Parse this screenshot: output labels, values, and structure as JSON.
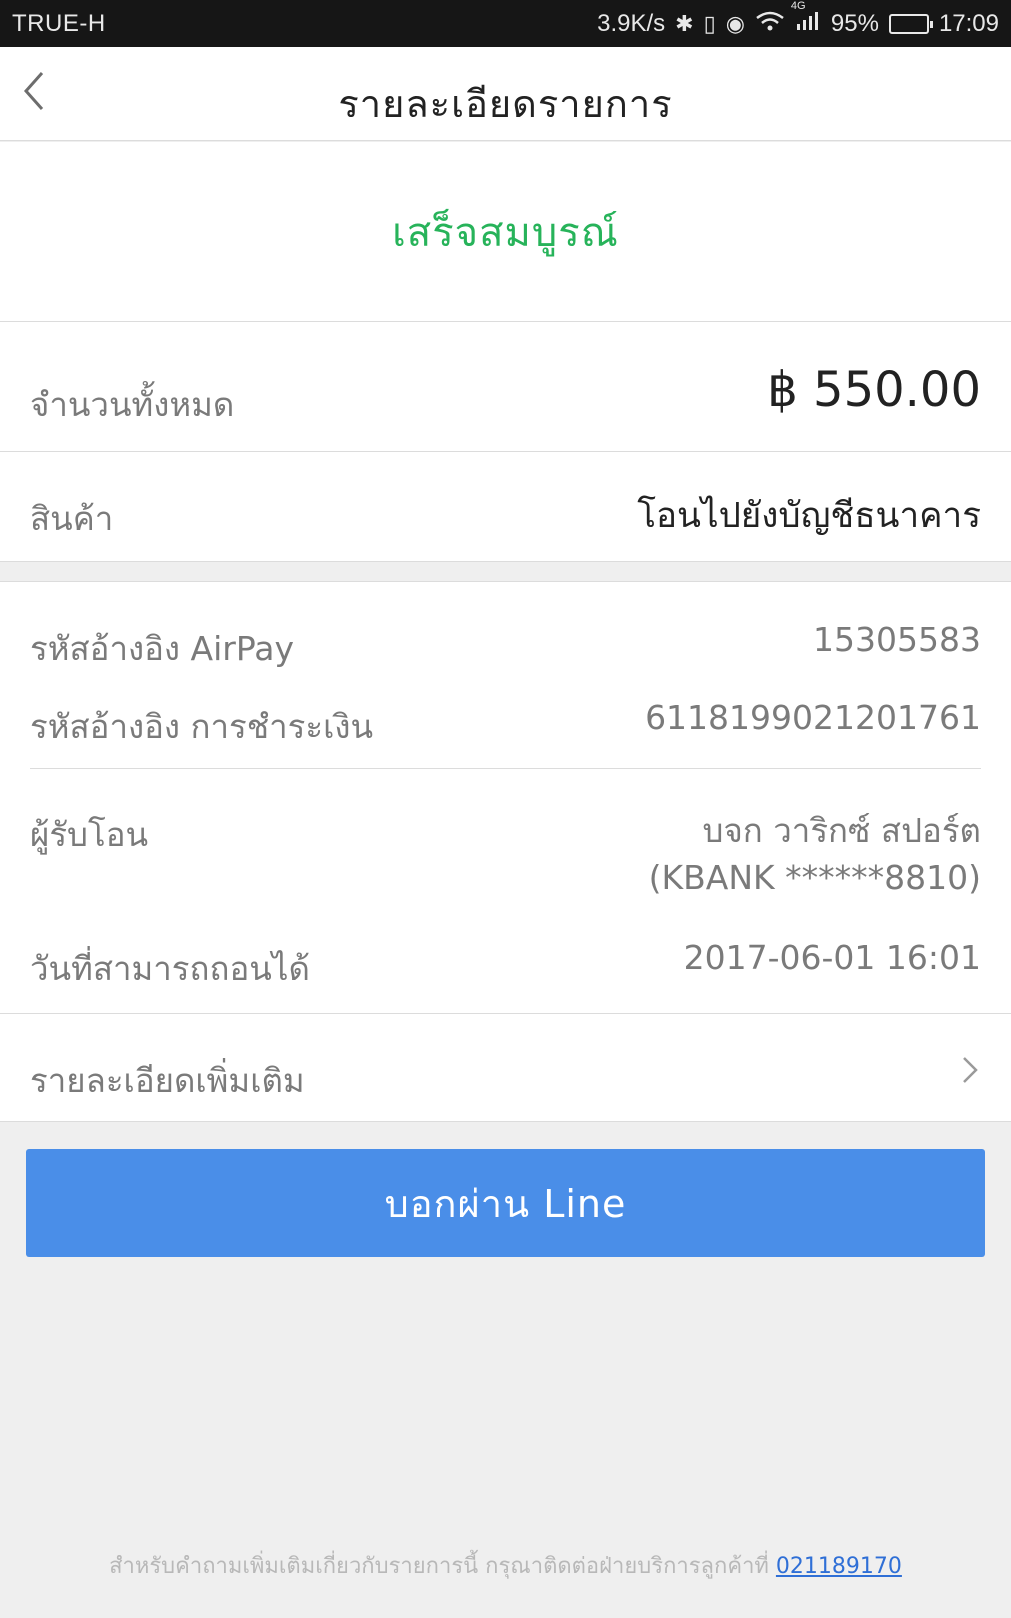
{
  "status_bar": {
    "carrier": "TRUE-H",
    "speed": "3.9K/s",
    "network": "4G",
    "battery": "95%",
    "battery_level": 0.95,
    "time": "17:09"
  },
  "header": {
    "title": "รายละเอียดรายการ"
  },
  "status": {
    "text": "เสร็จสมบูรณ์",
    "color": "#27b35a"
  },
  "summary": {
    "total_label": "จำนวนทั้งหมด",
    "total_value": "฿ 550.00",
    "product_label": "สินค้า",
    "product_value": "โอนไปยังบัญชีธนาคาร"
  },
  "details": {
    "airpay_ref_label": "รหัสอ้างอิง AirPay",
    "airpay_ref_value": "15305583",
    "payment_ref_label": "รหัสอ้างอิง การชำระเงิน",
    "payment_ref_value": "6118199021201761",
    "recipient_label": "ผู้รับโอน",
    "recipient_name": "บจก  วาริกซ์ สปอร์ต",
    "recipient_account": "(KBANK ******8810)",
    "withdraw_date_label": "วันที่สามารถถอนได้",
    "withdraw_date_value": "2017-06-01 16:01"
  },
  "more": {
    "label": "รายละเอียดเพิ่มเติม"
  },
  "share_button": {
    "label": "บอกผ่าน Line",
    "color": "#4a8ee8"
  },
  "footer": {
    "text": "สำหรับคำถามเพิ่มเติมเกี่ยวกับรายการนี้ กรุณาติดต่อฝ่ายบริการลูกค้าที่ ",
    "phone": "021189170"
  }
}
